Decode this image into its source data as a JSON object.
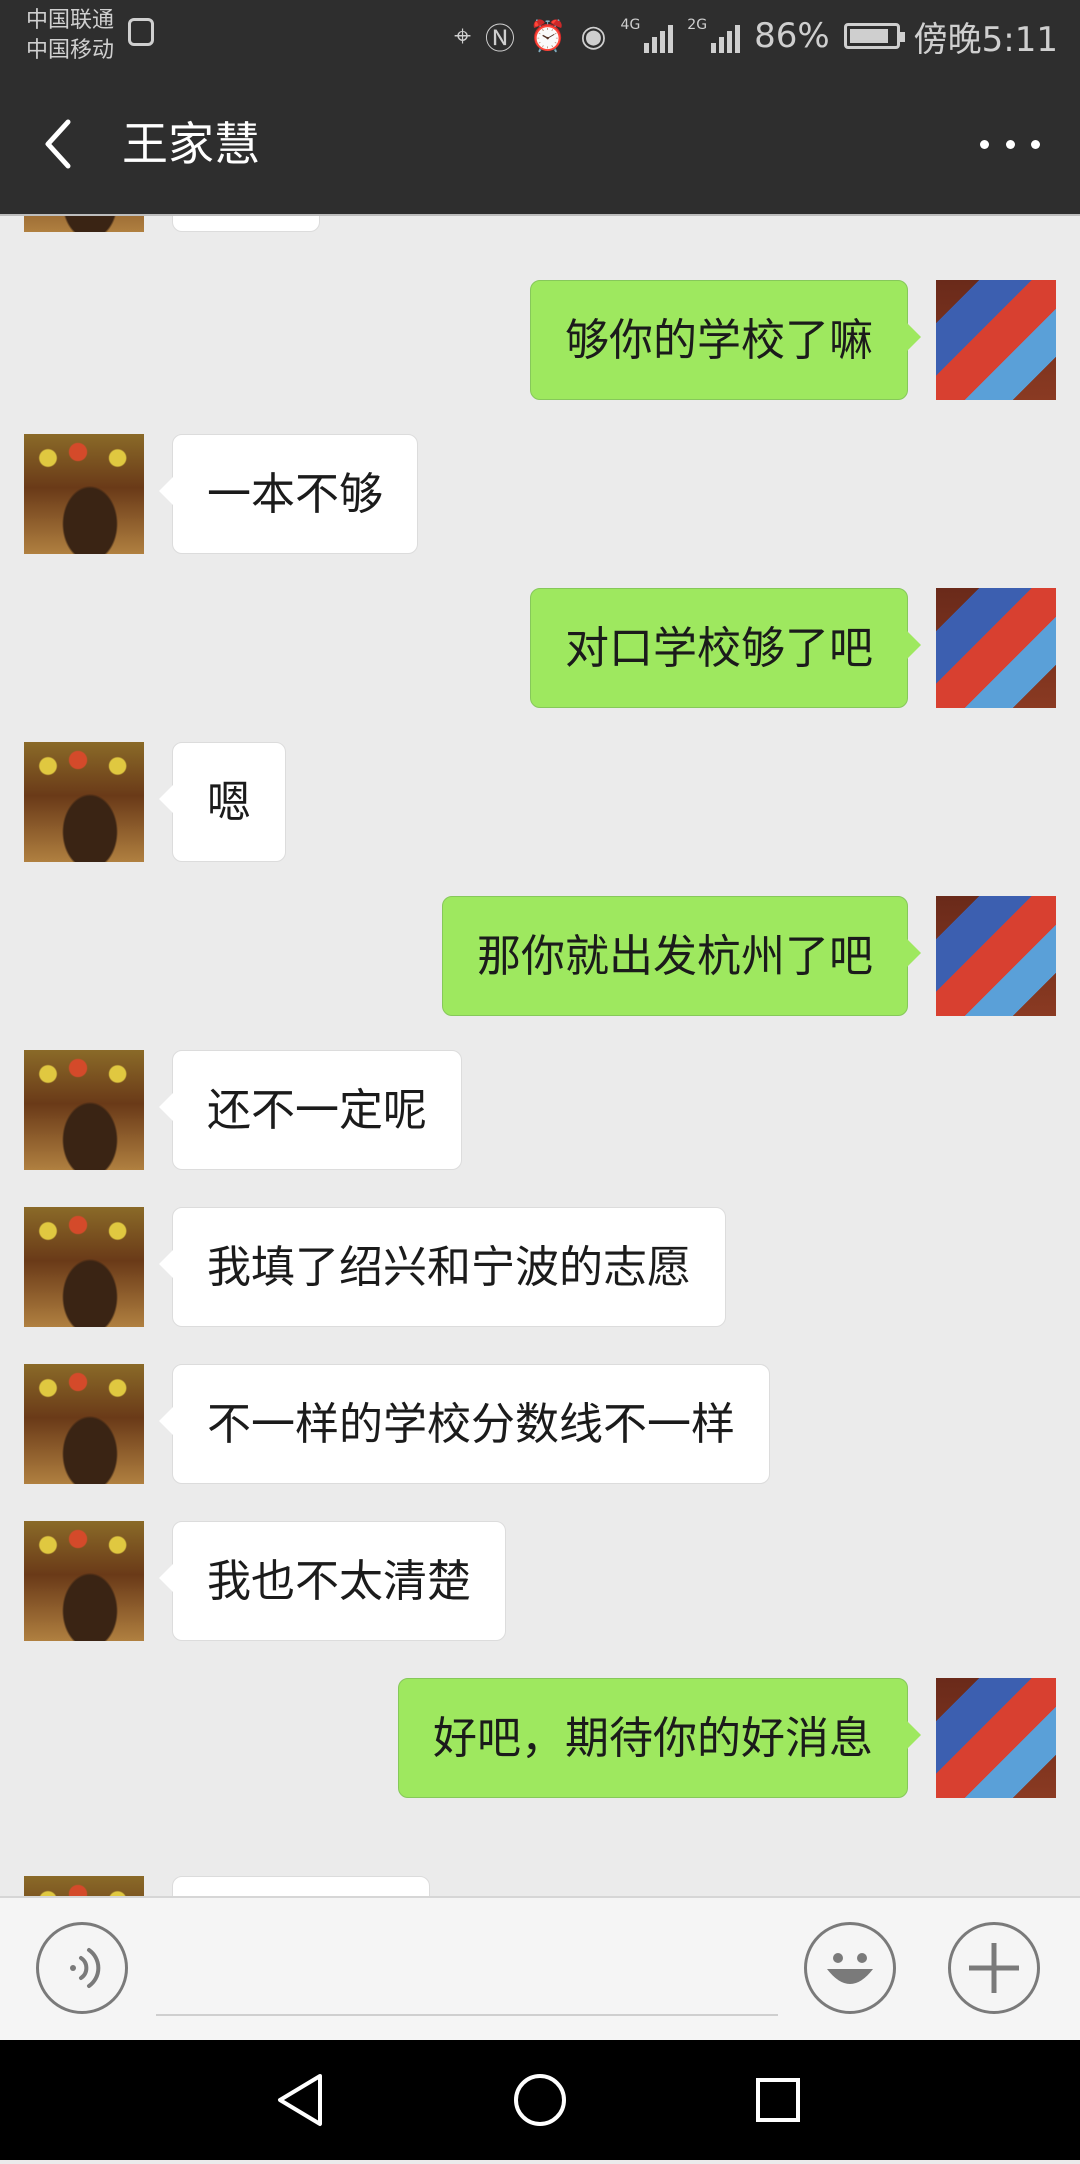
{
  "status_bar": {
    "carrier_1": "中国联通",
    "carrier_2": "中国移动",
    "network_1": "4G",
    "network_2": "2G",
    "battery": "86%",
    "battery_level": 0.86,
    "time": "傍晚5:11"
  },
  "nav": {
    "title": "王家慧"
  },
  "messages": [
    {
      "side": "out",
      "text": "够你的学校了嘛"
    },
    {
      "side": "in",
      "text": "一本不够"
    },
    {
      "side": "out",
      "text": "对口学校够了吧"
    },
    {
      "side": "in",
      "text": "嗯"
    },
    {
      "side": "out",
      "text": "那你就出发杭州了吧"
    },
    {
      "side": "in",
      "text": "还不一定呢"
    },
    {
      "side": "in",
      "text": "我填了绍兴和宁波的志愿"
    },
    {
      "side": "in",
      "text": "不一样的学校分数线不一样"
    },
    {
      "side": "in",
      "text": "我也不太清楚"
    },
    {
      "side": "out",
      "text": "好吧，期待你的好消息"
    }
  ],
  "icons": {
    "back": "chevron-left-icon",
    "more": "more-icon",
    "voice": "voice-icon",
    "emoji": "emoji-icon",
    "plus": "plus-icon",
    "nav_back": "triangle-back-icon",
    "nav_home": "circle-home-icon",
    "nav_recent": "square-recent-icon"
  },
  "colors": {
    "outgoing_bubble": "#9ee85f",
    "incoming_bubble": "#ffffff",
    "header": "#2e2e2e",
    "chat_background": "#ebebeb"
  }
}
